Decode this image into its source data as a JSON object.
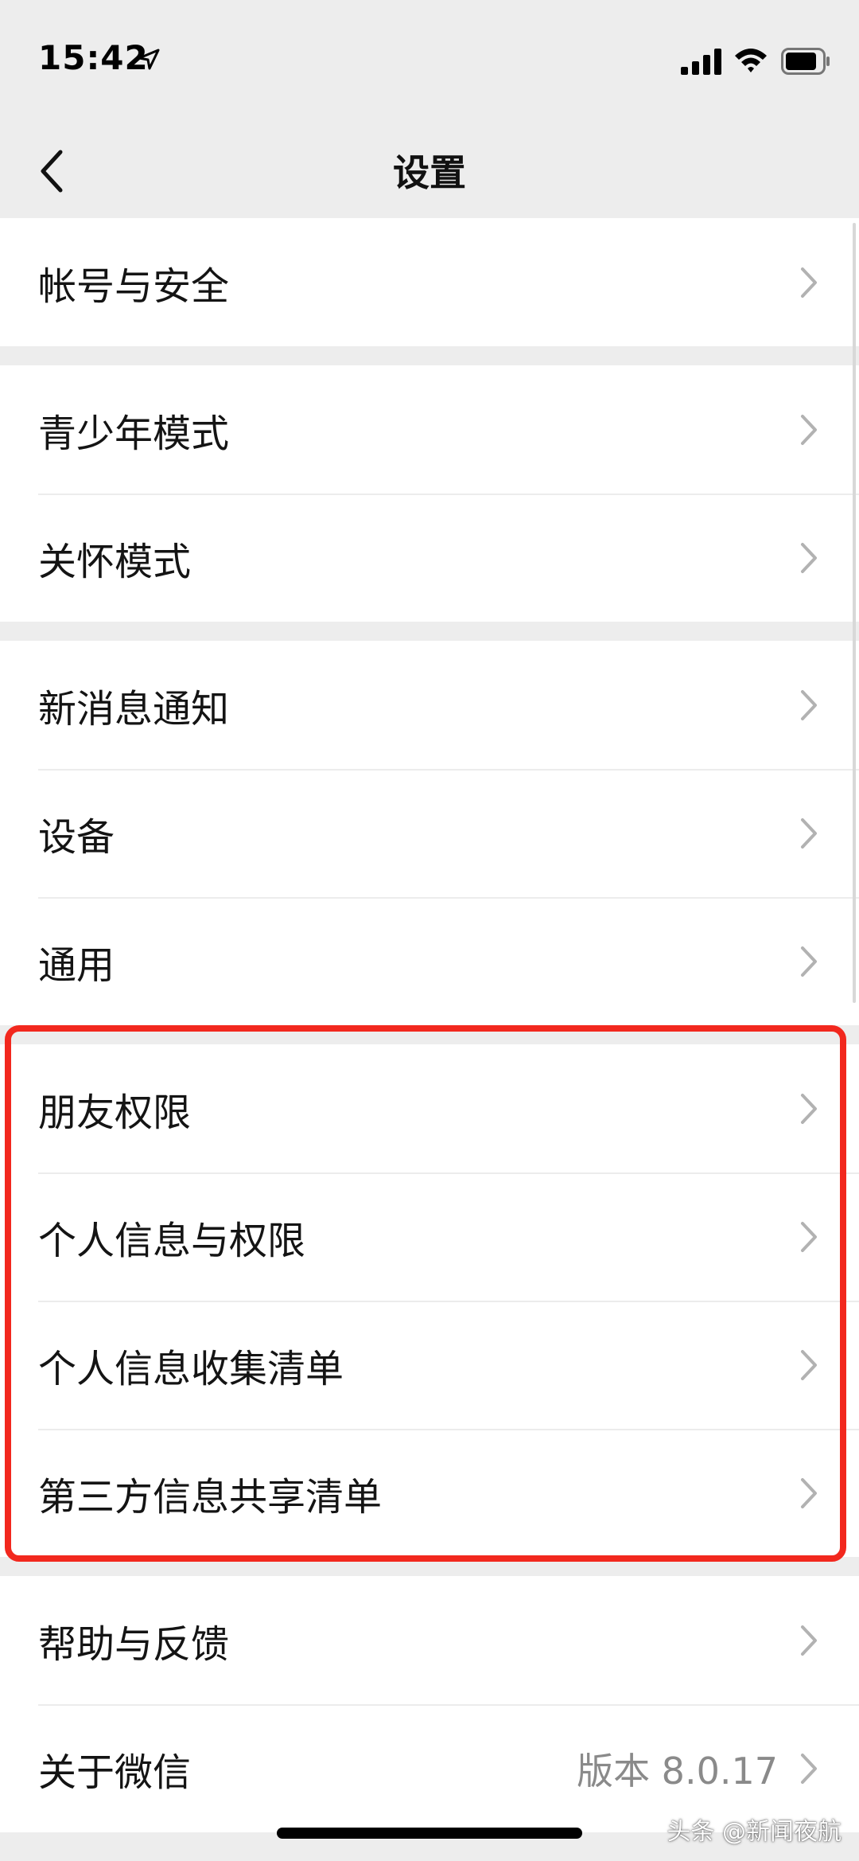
{
  "status_bar": {
    "time": "15:42",
    "icons": [
      "location-arrow-icon",
      "signal-icon",
      "wifi-icon",
      "battery-icon"
    ]
  },
  "nav": {
    "title": "设置",
    "back_icon": "chevron-left-icon"
  },
  "groups": [
    {
      "items": [
        {
          "label": "帐号与安全"
        }
      ]
    },
    {
      "items": [
        {
          "label": "青少年模式"
        },
        {
          "label": "关怀模式"
        }
      ]
    },
    {
      "items": [
        {
          "label": "新消息通知"
        },
        {
          "label": "设备"
        },
        {
          "label": "通用"
        }
      ]
    },
    {
      "items": [
        {
          "label": "朋友权限"
        },
        {
          "label": "个人信息与权限"
        },
        {
          "label": "个人信息收集清单"
        },
        {
          "label": "第三方信息共享清单"
        }
      ]
    },
    {
      "items": [
        {
          "label": "帮助与反馈"
        },
        {
          "label": "关于微信",
          "value": "版本 8.0.17"
        }
      ]
    }
  ],
  "highlight": {
    "color": "#f2281e",
    "covers_group": 3
  },
  "watermark": "头条 @新闻夜航",
  "colors": {
    "background": "#ededed",
    "card": "#ffffff",
    "text": "#141414",
    "secondary_text": "#8a8a8a",
    "highlight": "#f2281e"
  }
}
